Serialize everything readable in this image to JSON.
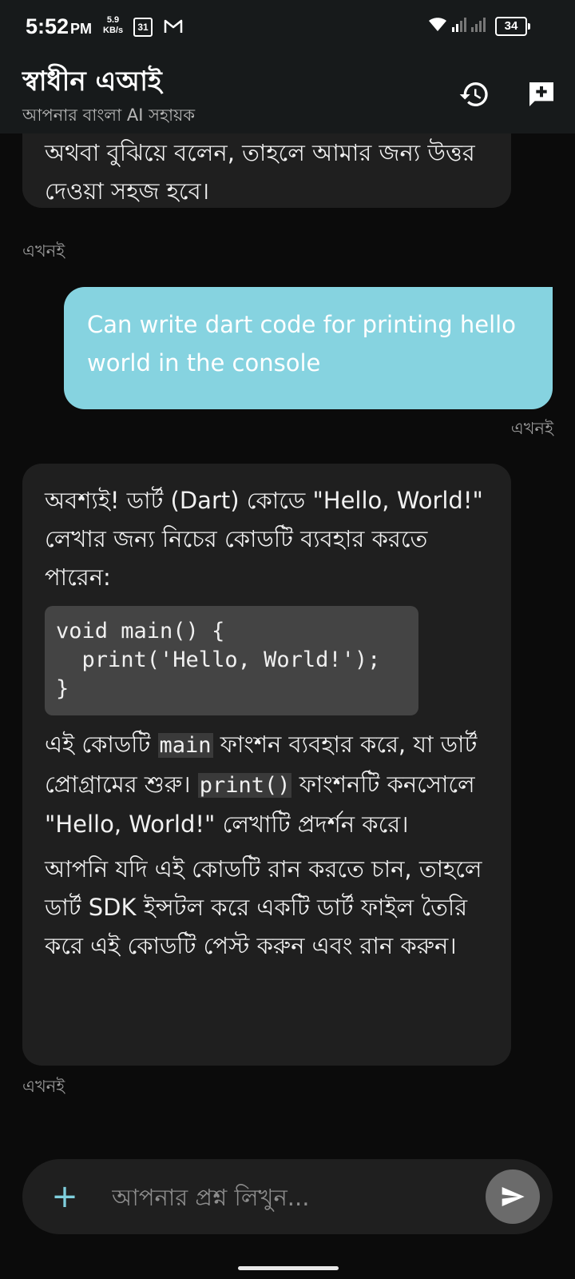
{
  "status_bar": {
    "time": "5:52",
    "ampm": "PM",
    "net_speed_value": "5.9",
    "net_speed_unit": "KB/s",
    "calendar_day": "31",
    "battery": "34"
  },
  "app_bar": {
    "title": "স্বাধীন এআই",
    "subtitle": "আপনার বাংলা AI সহায়ক",
    "icons": [
      "history-icon",
      "new-chat-icon"
    ]
  },
  "messages": [
    {
      "role": "assistant",
      "text": "অথবা বুঝিয়ে বলেন, তাহলে আমার জন্য উত্তর দেওয়া সহজ হবে।",
      "time": "এখনই"
    },
    {
      "role": "user",
      "text": "Can write dart code for printing hello world in the console",
      "time": "এখনই"
    },
    {
      "role": "assistant",
      "intro": "অবশ্যই! ডার্ট (Dart) কোডে \"Hello, World!\" লেখার জন্য নিচের কোডটি ব্যবহার করতে পারেন:",
      "code": "void main() {\n  print('Hello, World!');\n}",
      "explain_part1": "এই কোডটি ",
      "explain_code1": "main",
      "explain_part2": " ফাংশন ব্যবহার করে, যা ডার্ট প্রোগ্রামের শুরু। ",
      "explain_code2": "print()",
      "explain_part3": " ফাংশনটি কনসোলে \"Hello, World!\" লেখাটি প্রদর্শন করে।",
      "outro": "আপনি যদি এই কোডটি রান করতে চান, তাহলে ডার্ট SDK ইন্সটল করে একটি ডার্ট ফাইল তৈরি করে এই কোডটি পেস্ট করুন এবং রান করুন।",
      "time": "এখনই"
    }
  ],
  "input": {
    "placeholder": "আপনার প্রশ্ন লিখুন...",
    "value": "",
    "plus_label": "+"
  },
  "colors": {
    "background": "#0b0b0b",
    "bar": "#171a1b",
    "assistant_bubble": "#1f1f1f",
    "user_bubble": "#86d3e0",
    "accent": "#7fcfdd",
    "send_button": "#6b6b6b"
  }
}
